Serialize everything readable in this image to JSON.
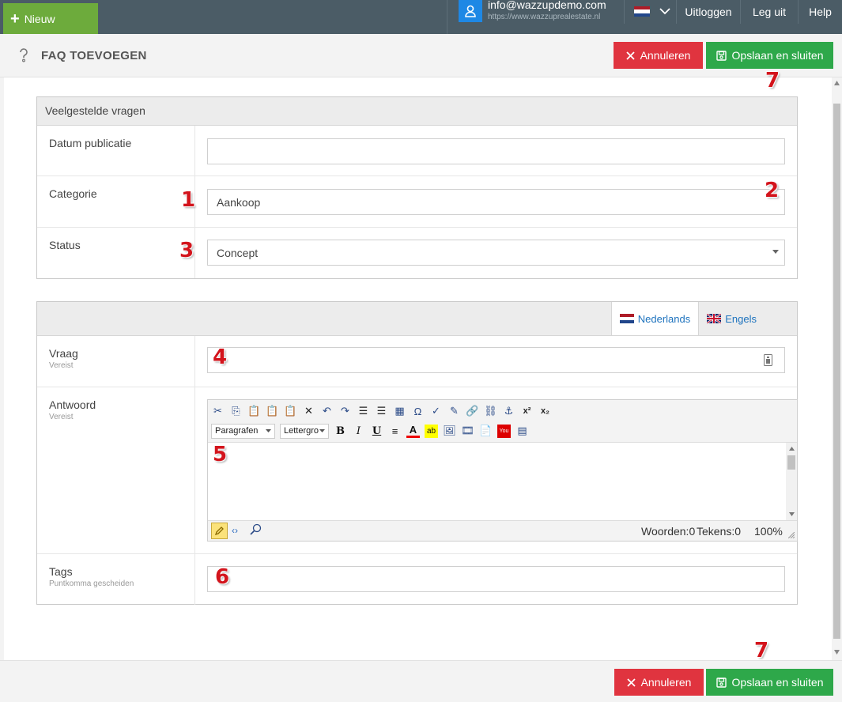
{
  "topbar": {
    "new_label": "Nieuw",
    "user_email": "info@wazzupdemo.com",
    "user_url": "https://www.wazzuprealestate.nl",
    "nav": [
      "Uitloggen",
      "Leg uit",
      "Help"
    ]
  },
  "header": {
    "title": "FAQ TOEVOEGEN",
    "cancel_label": "Annuleren",
    "save_label": "Opslaan en sluiten"
  },
  "panel1": {
    "title": "Veelgestelde vragen",
    "rows": {
      "date_label": "Datum publicatie",
      "date_value": "",
      "category_label": "Categorie",
      "category_value": "Aankoop",
      "status_label": "Status",
      "status_value": "Concept"
    }
  },
  "panel2": {
    "tabs": [
      "Nederlands",
      "Engels"
    ],
    "question_label": "Vraag",
    "question_sub": "Vereist",
    "answer_label": "Antwoord",
    "answer_sub": "Vereist",
    "tags_label": "Tags",
    "tags_sub": "Puntkomma gescheiden"
  },
  "editor": {
    "format_select": "Paragrafen",
    "font_select": "Lettergro",
    "status_words": "Woorden:0",
    "status_chars": "Tekens:0",
    "status_zoom": "100%"
  },
  "markers": [
    "1",
    "2",
    "3",
    "4",
    "5",
    "6",
    "7",
    "7"
  ],
  "colors": {
    "topbar": "#4b5c66",
    "new_button": "#6dab3c",
    "cancel_button": "#e0343f",
    "save_button": "#2ea84a",
    "marker": "#d3141c"
  }
}
